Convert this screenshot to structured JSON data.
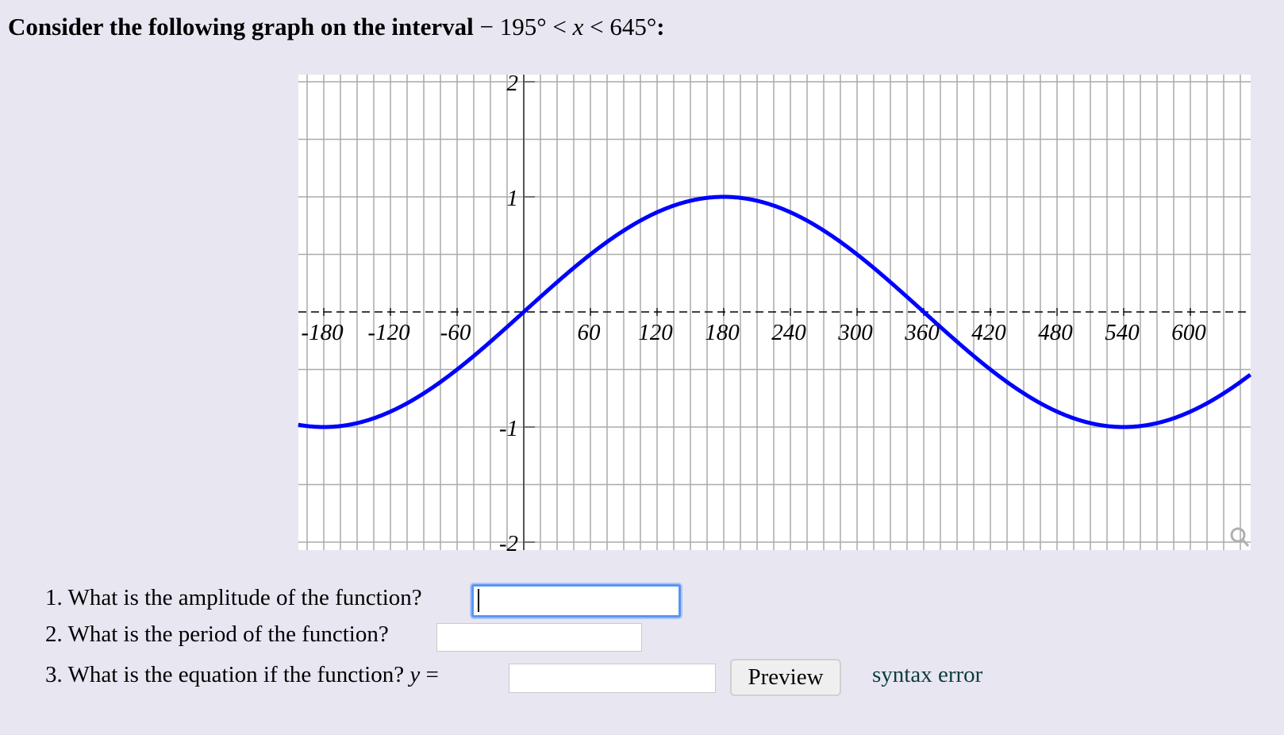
{
  "header": {
    "prefix": "Consider the following graph on the interval",
    "interval_lower": "− 195°",
    "lt1": "<",
    "variable": "x",
    "lt2": "<",
    "interval_upper": "645°",
    "suffix": ":"
  },
  "chart_data": {
    "type": "line",
    "title": "",
    "xlabel": "",
    "ylabel": "",
    "function": "y = sin(x/2)",
    "xlim": [
      -203,
      654
    ],
    "ylim": [
      -2.05,
      2.05
    ],
    "x_ticks": [
      -180,
      -120,
      -60,
      60,
      120,
      180,
      240,
      300,
      360,
      420,
      480,
      540,
      600
    ],
    "x_tick_labels": [
      "-180",
      "-120",
      "-60",
      "60",
      "120",
      "180",
      "240",
      "300",
      "360",
      "420",
      "480",
      "540",
      "600"
    ],
    "y_ticks": [
      2,
      1,
      -1,
      -2
    ],
    "y_tick_labels": [
      "2",
      "1",
      "-1",
      "-2"
    ],
    "x_grid_step": 15,
    "y_grid_step": 0.5,
    "grid": true,
    "series": [
      {
        "name": "curve",
        "color": "#0000ff",
        "x": [
          -203,
          -180,
          -135,
          -90,
          -45,
          0,
          45,
          90,
          135,
          180,
          225,
          270,
          315,
          360,
          405,
          450,
          495,
          540,
          585,
          630,
          654
        ],
        "y": [
          -0.98,
          -1,
          -0.924,
          -0.707,
          -0.383,
          0,
          0.383,
          0.707,
          0.924,
          1,
          0.924,
          0.707,
          0.383,
          0,
          -0.383,
          -0.707,
          -0.924,
          -1,
          -0.924,
          -0.707,
          -0.56
        ]
      }
    ],
    "axis_color": "#000000",
    "grid_color": "#aaaaaa",
    "zoom_icon": "magnifier-icon"
  },
  "questions": [
    {
      "label": "1. What is the amplitude of the function?",
      "value": ""
    },
    {
      "label": "2. What is the period of the function?",
      "value": ""
    },
    {
      "label": "3. What is the equation if the function?",
      "eq_var": "y",
      "eq_sign": "=",
      "value": ""
    }
  ],
  "preview_button": {
    "label": "Preview"
  },
  "status": {
    "text": "syntax error",
    "color": "#0b3d3b"
  }
}
